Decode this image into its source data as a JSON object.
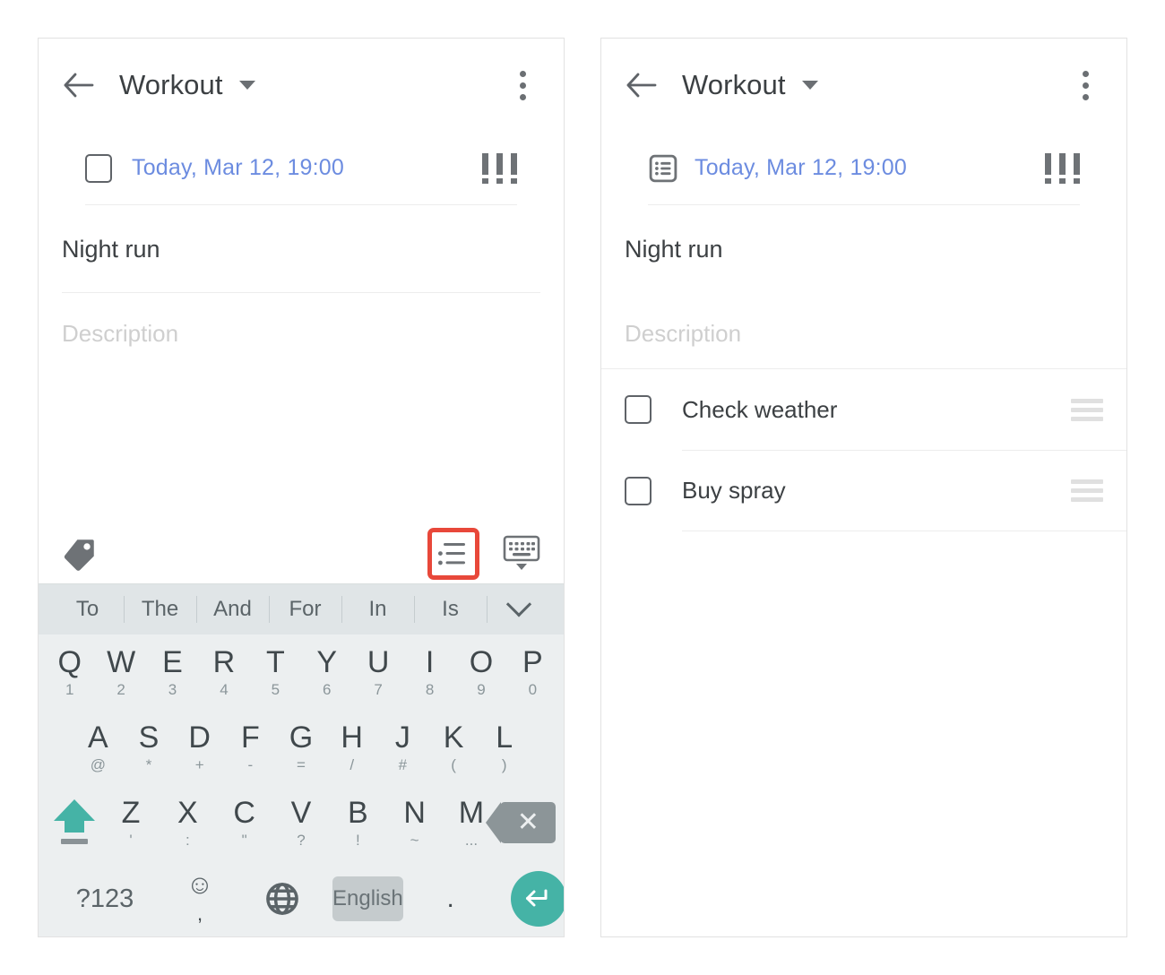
{
  "app": {
    "title": "Workout",
    "back_icon": "back-arrow-icon",
    "dropdown_icon": "chevron-down-icon",
    "overflow_icon": "more-vertical-icon"
  },
  "colors": {
    "accent_teal": "#45b3a6",
    "date_blue": "#6c8ce0",
    "highlight_red": "#e8483a",
    "text_primary": "#3c4043",
    "text_placeholder": "#cfcfcf",
    "keyboard_bg": "#eceff0",
    "suggest_bg": "#e0e5e7"
  },
  "left_panel": {
    "meta": {
      "lead_icon": "checkbox-icon",
      "date": "Today, Mar 12, 19:00",
      "priority_icon": "priority-high-icon"
    },
    "title_value": "Night run",
    "description_placeholder": "Description",
    "toolbar": {
      "tag_icon": "tag-icon",
      "subtask_icon": "list-icon",
      "subtask_highlighted": true,
      "keyboard_hide_icon": "keyboard-hide-icon"
    }
  },
  "right_panel": {
    "meta": {
      "lead_icon": "subtask-list-icon",
      "date": "Today, Mar 12, 19:00",
      "priority_icon": "priority-high-icon"
    },
    "title_value": "Night run",
    "description_placeholder": "Description",
    "subtasks": [
      {
        "label": "Check weather",
        "checked": false,
        "handle_icon": "drag-handle-icon"
      },
      {
        "label": "Buy spray",
        "checked": false,
        "handle_icon": "drag-handle-icon"
      }
    ]
  },
  "keyboard": {
    "suggestions": [
      "To",
      "The",
      "And",
      "For",
      "In",
      "Is"
    ],
    "more_icon": "chevron-down-icon",
    "row1": [
      {
        "key": "Q",
        "alt": "1"
      },
      {
        "key": "W",
        "alt": "2"
      },
      {
        "key": "E",
        "alt": "3"
      },
      {
        "key": "R",
        "alt": "4"
      },
      {
        "key": "T",
        "alt": "5"
      },
      {
        "key": "Y",
        "alt": "6"
      },
      {
        "key": "U",
        "alt": "7"
      },
      {
        "key": "I",
        "alt": "8"
      },
      {
        "key": "O",
        "alt": "9"
      },
      {
        "key": "P",
        "alt": "0"
      }
    ],
    "row2": [
      {
        "key": "A",
        "alt": "@"
      },
      {
        "key": "S",
        "alt": "*"
      },
      {
        "key": "D",
        "alt": "+"
      },
      {
        "key": "F",
        "alt": "-"
      },
      {
        "key": "G",
        "alt": "="
      },
      {
        "key": "H",
        "alt": "/"
      },
      {
        "key": "J",
        "alt": "#"
      },
      {
        "key": "K",
        "alt": "("
      },
      {
        "key": "L",
        "alt": ")"
      }
    ],
    "row3": [
      {
        "key": "Z",
        "alt": "'"
      },
      {
        "key": "X",
        "alt": ":"
      },
      {
        "key": "C",
        "alt": "\""
      },
      {
        "key": "V",
        "alt": "?"
      },
      {
        "key": "B",
        "alt": "!"
      },
      {
        "key": "N",
        "alt": "~"
      },
      {
        "key": "M",
        "alt": "..."
      }
    ],
    "shift_icon": "shift-icon",
    "backspace_icon": "backspace-icon",
    "row4": {
      "symbols_label": "?123",
      "emoji_icon": "emoji-icon",
      "emoji_alt": ",",
      "globe_icon": "language-globe-icon",
      "space_label": "English",
      "period_label": ".",
      "enter_icon": "enter-icon"
    }
  }
}
